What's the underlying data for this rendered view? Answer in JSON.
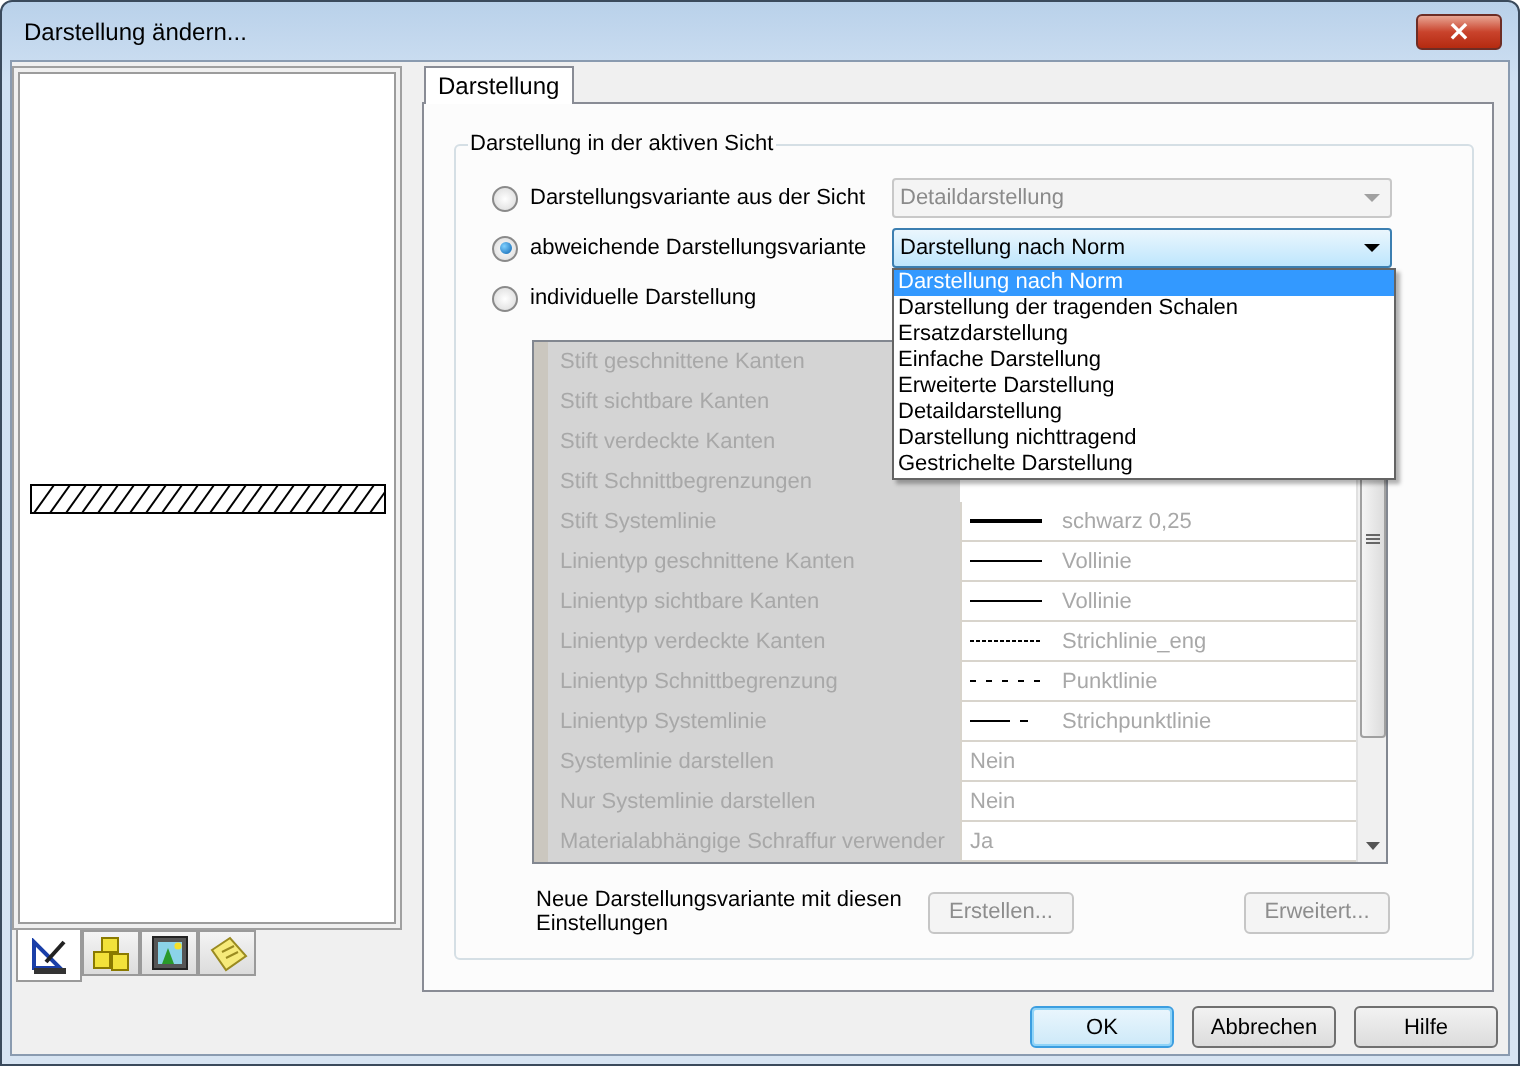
{
  "window": {
    "title": "Darstellung ändern...",
    "close": "×"
  },
  "left_tabs": [
    {
      "kind": "ruler",
      "selected": true
    },
    {
      "kind": "cubes",
      "selected": false
    },
    {
      "kind": "image",
      "selected": false
    },
    {
      "kind": "note",
      "selected": false
    }
  ],
  "tabs": [
    {
      "label": "Darstellung",
      "selected": true
    }
  ],
  "group": {
    "title": "Darstellung in der aktiven Sicht",
    "options": [
      {
        "label": "Darstellungsvariante aus der Sicht",
        "selected": false,
        "combo": {
          "value": "Detaildarstellung",
          "disabled": true,
          "open": false
        }
      },
      {
        "label": "abweichende Darstellungsvariante",
        "selected": true,
        "combo": {
          "value": "Darstellung nach Norm",
          "disabled": false,
          "open": true,
          "options": [
            {
              "label": "Darstellung nach Norm",
              "selected": true
            },
            {
              "label": "Darstellung der tragenden Schalen",
              "selected": false
            },
            {
              "label": "Ersatzdarstellung",
              "selected": false
            },
            {
              "label": "Einfache Darstellung",
              "selected": false
            },
            {
              "label": "Erweiterte Darstellung",
              "selected": false
            },
            {
              "label": "Detaildarstellung",
              "selected": false
            },
            {
              "label": "Darstellung nichttragend",
              "selected": false
            },
            {
              "label": "Gestrichelte Darstellung",
              "selected": false
            }
          ]
        }
      },
      {
        "label": "individuelle Darstellung",
        "selected": false
      }
    ],
    "table": {
      "disabled": true,
      "rows": [
        {
          "label": "Stift geschnittene Kanten"
        },
        {
          "label": "Stift sichtbare Kanten"
        },
        {
          "label": "Stift verdeckte Kanten"
        },
        {
          "label": "Stift Schnittbegrenzungen"
        },
        {
          "label": "Stift Systemlinie",
          "kind": "thick",
          "value": "schwarz 0,25"
        },
        {
          "label": "Linientyp geschnittene Kanten",
          "kind": "solid",
          "value": "Vollinie"
        },
        {
          "label": "Linientyp sichtbare Kanten",
          "kind": "solid",
          "value": "Vollinie"
        },
        {
          "label": "Linientyp verdeckte Kanten",
          "kind": "dashed",
          "value": "Strichlinie_eng"
        },
        {
          "label": "Linientyp Schnittbegrenzung",
          "kind": "dotted",
          "value": "Punktlinie"
        },
        {
          "label": "Linientyp Systemlinie",
          "kind": "dashdot",
          "value": "Strichpunktlinie"
        },
        {
          "label": "Systemlinie darstellen",
          "kind": "text",
          "value": "Nein"
        },
        {
          "label": "Nur Systemlinie darstellen",
          "kind": "text",
          "value": "Nein"
        },
        {
          "label": "Materialabhängige Schraffur verwender",
          "kind": "text",
          "value": "Ja"
        }
      ]
    },
    "note": "Neue Darstellungsvariante mit diesen Einstellungen",
    "group_buttons": [
      {
        "label": "Erstellen...",
        "disabled": true
      },
      {
        "label": "Erweitert...",
        "disabled": true
      }
    ]
  },
  "buttons": [
    {
      "label": "OK",
      "default": true
    },
    {
      "label": "Abbrechen",
      "default": false
    },
    {
      "label": "Hilfe",
      "default": false
    }
  ]
}
